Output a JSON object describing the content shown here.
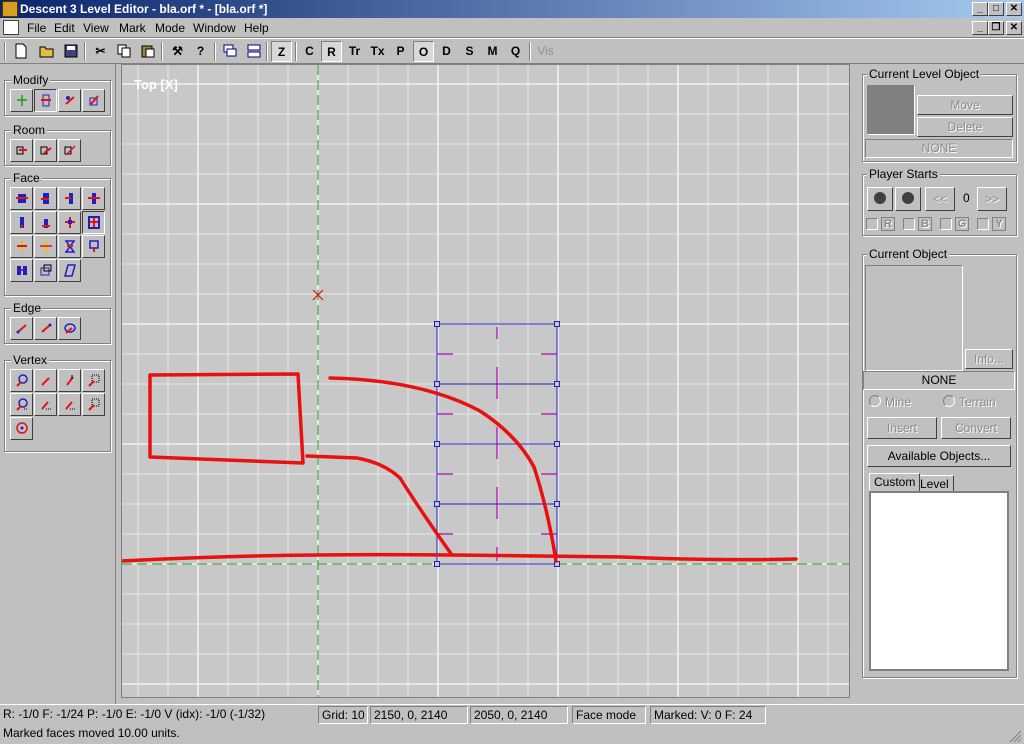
{
  "window": {
    "title": "Descent 3 Level Editor - bla.orf * - [bla.orf *]",
    "min_glyph": "_",
    "max_glyph": "□",
    "close_glyph": "✕",
    "restore_glyph": "❐"
  },
  "menu": [
    "File",
    "Edit",
    "View",
    "Mark",
    "Mode",
    "Window",
    "Help"
  ],
  "toolbar": {
    "buttons": [
      "Z",
      "C",
      "R",
      "Tr",
      "Tx",
      "P",
      "O",
      "D",
      "S",
      "M",
      "Q",
      "Vis"
    ],
    "pressed": [
      "Z",
      "R",
      "O"
    ]
  },
  "left_tools": {
    "groups": [
      "Modify",
      "Room",
      "Face",
      "Edge",
      "Vertex"
    ]
  },
  "viewport": {
    "label": "Top [X]",
    "grid_color": "#f0f0f0",
    "axis_color": "#1a9a1a",
    "sketch_color": "#e81010",
    "room_color": "#2020c0",
    "marker_color": "#b000b0"
  },
  "right_panel": {
    "current_level_object": {
      "title": "Current Level Object",
      "move": "Move",
      "delete": "Delete",
      "status": "NONE"
    },
    "player_starts": {
      "title": "Player Starts",
      "prev": "<<",
      "next": ">>",
      "count": "0",
      "teams": [
        "R",
        "B",
        "G",
        "Y"
      ]
    },
    "current_object": {
      "title": "Current Object",
      "info": "Info...",
      "status": "NONE",
      "mine": "Mine",
      "terrain": "Terrain",
      "insert": "Insert",
      "convert": "Convert",
      "available": "Available Objects...",
      "tabs": [
        "Custom",
        "Level"
      ]
    }
  },
  "status": {
    "pos": "R: -1/0 F: -1/24 P: -1/0 E: -1/0 V (idx): -1/0 (-1/32)",
    "grid": "Grid: 10",
    "coord1": "2150, 0, 2140",
    "coord2": "2050, 0, 2140",
    "mode": "Face mode",
    "marked": "Marked: V: 0 F: 24",
    "message": "Marked faces moved 10.00 units."
  }
}
